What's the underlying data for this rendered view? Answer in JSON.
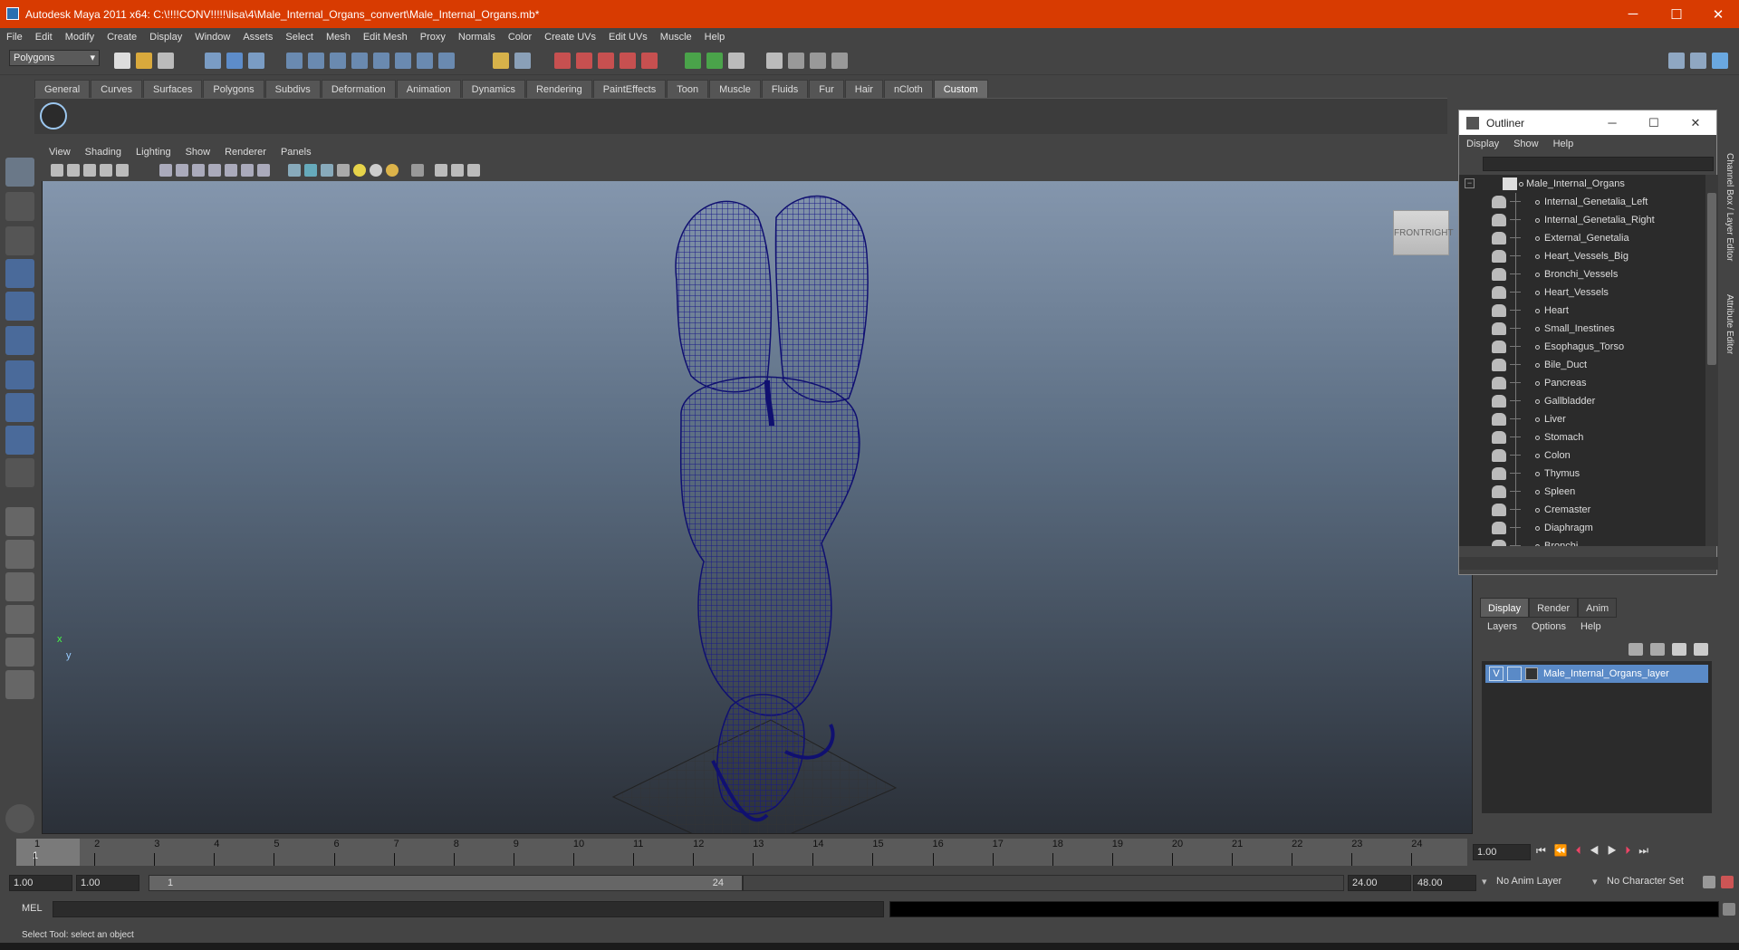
{
  "window": {
    "title": "Autodesk Maya 2011 x64: C:\\!!!!CONV!!!!!\\lisa\\4\\Male_Internal_Organs_convert\\Male_Internal_Organs.mb*",
    "min": "─",
    "max": "☐",
    "close": "✕"
  },
  "menus": [
    "File",
    "Edit",
    "Modify",
    "Create",
    "Display",
    "Window",
    "Assets",
    "Select",
    "Mesh",
    "Edit Mesh",
    "Proxy",
    "Normals",
    "Color",
    "Create UVs",
    "Edit UVs",
    "Muscle",
    "Help"
  ],
  "mode_select": "Polygons",
  "shelf_tabs": [
    "General",
    "Curves",
    "Surfaces",
    "Polygons",
    "Subdivs",
    "Deformation",
    "Animation",
    "Dynamics",
    "Rendering",
    "PaintEffects",
    "Toon",
    "Muscle",
    "Fluids",
    "Fur",
    "Hair",
    "nCloth",
    "Custom"
  ],
  "shelf_active": "Custom",
  "panel_menu": [
    "View",
    "Shading",
    "Lighting",
    "Show",
    "Renderer",
    "Panels"
  ],
  "viewcube": {
    "front": "FRONT",
    "right": "RIGHT"
  },
  "axis": {
    "x": "x",
    "y": "y"
  },
  "timeline": {
    "ticks": [
      "1",
      "2",
      "3",
      "4",
      "5",
      "6",
      "7",
      "8",
      "9",
      "10",
      "11",
      "12",
      "13",
      "14",
      "15",
      "16",
      "17",
      "18",
      "19",
      "20",
      "21",
      "22",
      "23",
      "24"
    ],
    "current": "1",
    "current_field": "1.00"
  },
  "range": {
    "start": "1.00",
    "playback_start": "1.00",
    "slider_min": "1",
    "slider_max": "24",
    "playback_end": "24.00",
    "end": "48.00",
    "anim_layer": "No Anim Layer",
    "char_set": "No Character Set"
  },
  "cmd": {
    "label": "MEL"
  },
  "helpline": "Select Tool: select an object",
  "outliner": {
    "title": "Outliner",
    "menu": [
      "Display",
      "Show",
      "Help"
    ],
    "root": "Male_Internal_Organs",
    "items": [
      "Internal_Genetalia_Left",
      "Internal_Genetalia_Right",
      "External_Genetalia",
      "Heart_Vessels_Big",
      "Bronchi_Vessels",
      "Heart_Vessels",
      "Heart",
      "Small_Inestines",
      "Esophagus_Torso",
      "Bile_Duct",
      "Pancreas",
      "Gallbladder",
      "Liver",
      "Stomach",
      "Colon",
      "Thymus",
      "Spleen",
      "Cremaster",
      "Diaphragm",
      "Bronchi"
    ],
    "win": {
      "min": "─",
      "max": "☐",
      "close": "✕"
    }
  },
  "layer_editor": {
    "tabs": [
      "Display",
      "Render",
      "Anim"
    ],
    "active_tab": "Display",
    "menu": [
      "Layers",
      "Options",
      "Help"
    ],
    "layer": {
      "v": "V",
      "name": "Male_Internal_Organs_layer"
    }
  },
  "side_tabs": [
    "Channel Box / Layer Editor",
    "Attribute Editor"
  ],
  "colors": {
    "titlebar": "#d83b01",
    "wire": "#14147a",
    "selected_layer": "#5a8ac7"
  }
}
